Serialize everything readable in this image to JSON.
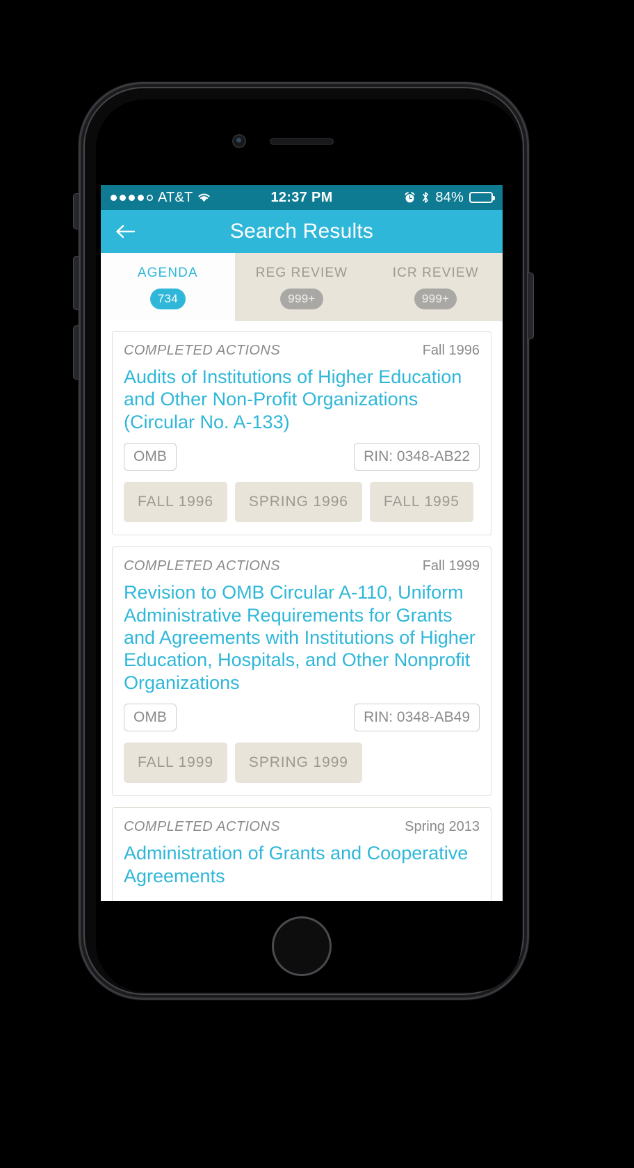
{
  "device": {
    "status_bar": {
      "carrier": "AT&T",
      "signal_dots_filled": 4,
      "signal_dots_total": 5,
      "wifi_icon": "wifi-icon",
      "time": "12:37 PM",
      "alarm_icon": "alarm-clock-icon",
      "bluetooth_icon": "bluetooth-icon",
      "battery_percent": "84%",
      "battery_level": 84
    }
  },
  "navbar": {
    "back_icon": "back-arrow-icon",
    "title": "Search Results"
  },
  "tabs": [
    {
      "label": "AGENDA",
      "badge": "734",
      "active": true
    },
    {
      "label": "REG REVIEW",
      "badge": "999+",
      "active": false
    },
    {
      "label": "ICR REVIEW",
      "badge": "999+",
      "active": false
    }
  ],
  "results": [
    {
      "kind": "COMPLETED ACTIONS",
      "term": "Fall 1996",
      "title": "Audits of Institutions of Higher Education and Other Non-Profit Organizations (Circular No. A-133)",
      "agency": "OMB",
      "rin": "RIN: 0348-AB22",
      "chips": [
        "FALL 1996",
        "SPRING 1996",
        "FALL 1995"
      ]
    },
    {
      "kind": "COMPLETED ACTIONS",
      "term": "Fall 1999",
      "title": "Revision to OMB Circular A-110, Uniform Administrative Requirements for Grants and Agreements with Institutions of Higher Education, Hospitals, and Other Nonprofit Organizations",
      "agency": "OMB",
      "rin": "RIN: 0348-AB49",
      "chips": [
        "FALL 1999",
        "SPRING 1999"
      ]
    },
    {
      "kind": "COMPLETED ACTIONS",
      "term": "Spring 2013",
      "title": "Administration of Grants and Cooperative Agreements",
      "agency": "",
      "rin": "",
      "chips": []
    }
  ],
  "colors": {
    "accent": "#2fb7d9",
    "status_bar": "#0e7b93",
    "tab_inactive_bg": "#e8e4da",
    "muted_text": "#9d9991",
    "chip_bg": "#e8e4da"
  }
}
